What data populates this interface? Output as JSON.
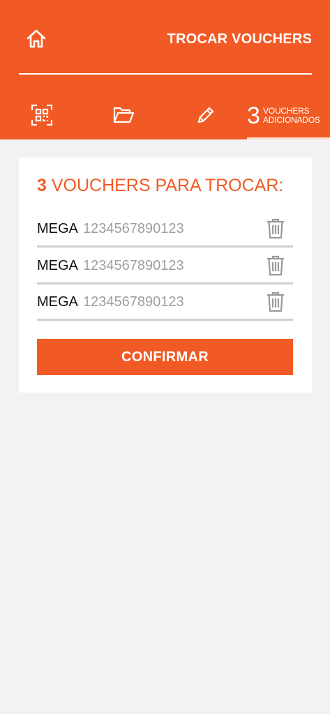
{
  "header": {
    "title": "TROCAR VOUCHERS",
    "home_icon": "home-icon"
  },
  "tabs": {
    "qr_icon": "qr-code-icon",
    "folder_icon": "folder-icon",
    "edit_icon": "pencil-icon",
    "added_count": "3",
    "added_label_line1": "VOUCHERS",
    "added_label_line2": "ADICIONADOS"
  },
  "card": {
    "heading_count": "3",
    "heading_text": " VOUCHERS PARA TROCAR:",
    "vouchers": [
      {
        "brand": "MEGA",
        "code": "1234567890123"
      },
      {
        "brand": "MEGA",
        "code": "1234567890123"
      },
      {
        "brand": "MEGA",
        "code": "1234567890123"
      }
    ],
    "confirm_label": "CONFIRMAR"
  },
  "colors": {
    "accent": "#f15a24",
    "background": "#f2f2f2",
    "card": "#ffffff",
    "code_text": "#9e9e9e",
    "divider": "#cfcfcf"
  }
}
